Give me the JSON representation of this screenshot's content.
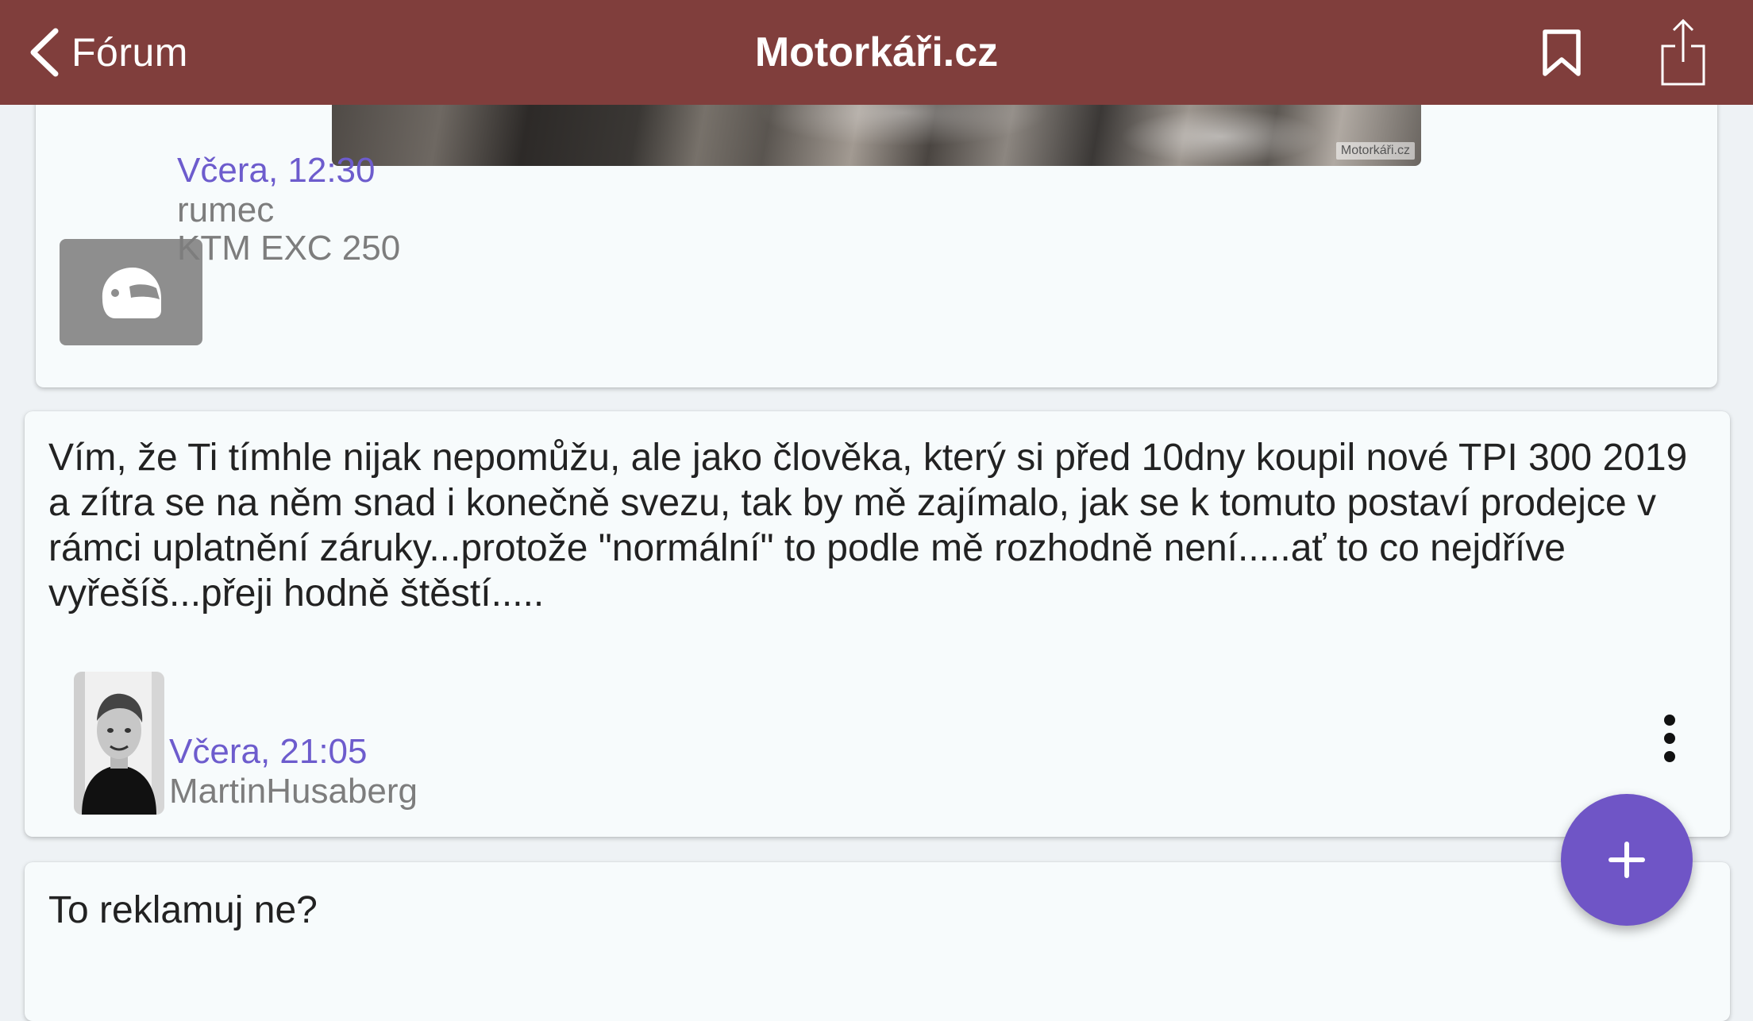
{
  "navbar": {
    "back_label": "Fórum",
    "title": "Motorkáři.cz",
    "background_color": "#803e3c",
    "back_icon": "chevron-left-icon",
    "bookmark_icon": "bookmark-icon",
    "share_icon": "share-icon"
  },
  "posts": [
    {
      "image_watermark": "Motorkáři.cz",
      "date": "Včera, 12:30",
      "author": "rumec",
      "bike": "KTM EXC 250",
      "avatar_icon": "helmet-icon"
    },
    {
      "text": "Vím, že Ti tímhle nijak nepomůžu, ale jako člověka, který si před 10dny koupil nové TPI 300 2019 a zítra se na něm snad i konečně svezu, tak by mě zajímalo, jak se k tomuto postaví prodejce v rámci uplatnění záruky...protože \"normální\" to podle mě rozhodně není.....ať to co nejdříve vyřešíš...přeji hodně štěstí.....",
      "date": "Včera, 21:05",
      "author": "MartinHusaberg",
      "more_icon": "more-vertical-icon"
    },
    {
      "text": "To reklamuj ne?"
    }
  ],
  "fab": {
    "icon": "plus-icon",
    "color": "#6f55c6"
  },
  "accent_color": "#6d5ccd"
}
